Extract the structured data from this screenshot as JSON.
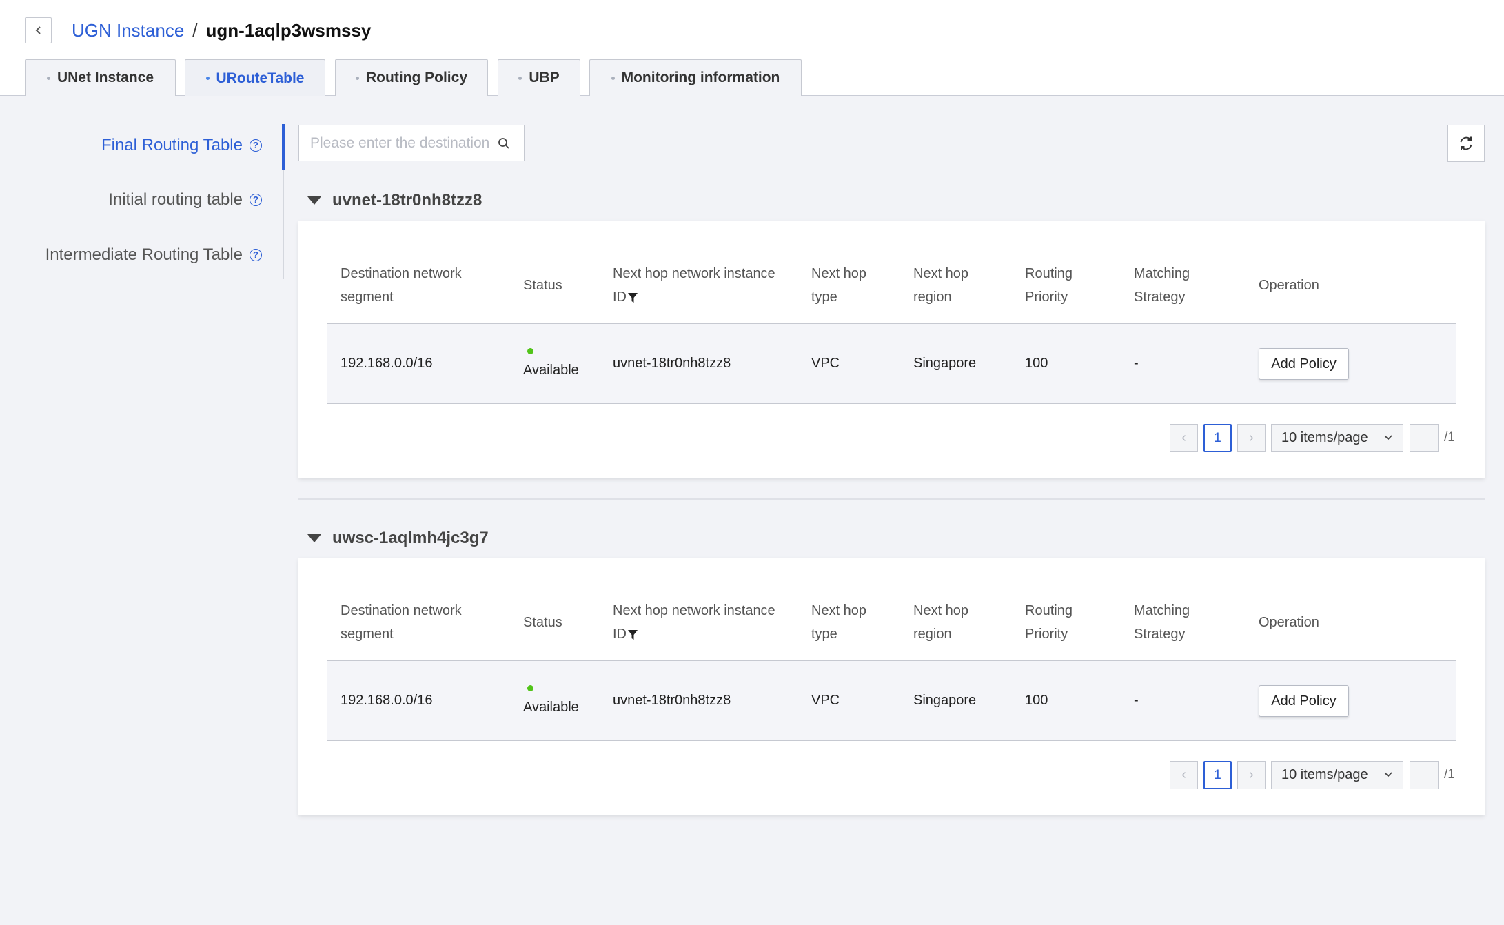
{
  "breadcrumb": {
    "parent": "UGN Instance",
    "separator": "/",
    "current": "ugn-1aqlp3wsmssy"
  },
  "tabs": [
    {
      "label": "UNet Instance",
      "active": false
    },
    {
      "label": "URouteTable",
      "active": true
    },
    {
      "label": "Routing Policy",
      "active": false
    },
    {
      "label": "UBP",
      "active": false
    },
    {
      "label": "Monitoring information",
      "active": false
    }
  ],
  "sidenav": {
    "items": [
      {
        "label": "Final Routing Table",
        "active": true
      },
      {
        "label": "Initial routing table",
        "active": false
      },
      {
        "label": "Intermediate Routing Table",
        "active": false
      }
    ]
  },
  "search": {
    "placeholder": "Please enter the destination",
    "value": ""
  },
  "table_headers": {
    "dest": [
      "Destination network",
      "segment"
    ],
    "status": "Status",
    "nexthop_id": [
      "Next hop network instance",
      "ID"
    ],
    "nexthop_type": [
      "Next hop",
      "type"
    ],
    "nexthop_region": [
      "Next hop",
      "region"
    ],
    "priority": [
      "Routing",
      "Priority"
    ],
    "strategy": [
      "Matching",
      "Strategy"
    ],
    "operation": "Operation"
  },
  "groups": [
    {
      "name": "uvnet-18tr0nh8tzz8",
      "row": {
        "dest": "192.168.0.0/16",
        "status": "Available",
        "nexthop_id": "uvnet-18tr0nh8tzz8",
        "nexthop_type": "VPC",
        "nexthop_region": "Singapore",
        "priority": "100",
        "strategy": "-",
        "action": "Add Policy"
      },
      "pager": {
        "current": "1",
        "page_size": "10 items/page",
        "total": "/1"
      }
    },
    {
      "name": "uwsc-1aqlmh4jc3g7",
      "row": {
        "dest": "192.168.0.0/16",
        "status": "Available",
        "nexthop_id": "uvnet-18tr0nh8tzz8",
        "nexthop_type": "VPC",
        "nexthop_region": "Singapore",
        "priority": "100",
        "strategy": "-",
        "action": "Add Policy"
      },
      "pager": {
        "current": "1",
        "page_size": "10 items/page",
        "total": "/1"
      }
    }
  ],
  "colors": {
    "accent": "#2d5fd6",
    "status_available": "#52c41a",
    "background": "#f2f3f7"
  }
}
